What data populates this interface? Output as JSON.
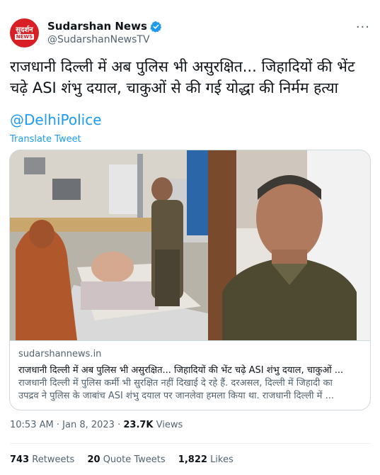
{
  "account": {
    "display_name": "Sudarshan News",
    "handle": "@SudarshanNewsTV",
    "avatar_text_top": "सुदर्शन",
    "avatar_text_bottom": "NEWS",
    "verified": true
  },
  "tweet": {
    "line1": "राजधानी दिल्ली में अब पुलिस भी असुरक्षित... जिहादियों की भेंट",
    "line2": "चढ़े ASI शंभु दयाल, चाकुओं से की गई योद्धा की निर्मम हत्या",
    "mention": "@DelhiPolice",
    "translate_label": "Translate Tweet"
  },
  "card": {
    "domain": "sudarshannews.in",
    "title": "राजधानी दिल्ली में अब पुलिस भी असुरक्षित... जिहादियों की भेंट चढ़े ASI शंभु दयाल, चाकुओं ...",
    "desc_line1": "राजधानी दिल्ली में पुलिस कर्मी भी सुरक्षित नहीं दिखाई दे रहे हैं. दरअसल, दिल्ली में जिहादी का",
    "desc_line2": "उपद्रव ने पुलिस के जाबांच ASI शंभु दयाल पर जानलेवा हमला किया था. राजधानी दिल्ली में ..."
  },
  "meta": {
    "time": "10:53 AM",
    "separator": "·",
    "date": "Jan 8, 2023",
    "views_count": "23.7K",
    "views_label": "Views"
  },
  "stats": {
    "retweets_count": "743",
    "retweets_label": "Retweets",
    "quotes_count": "20",
    "quotes_label": "Quote Tweets",
    "likes_count": "1,822",
    "likes_label": "Likes"
  },
  "colors": {
    "accent": "#1d9bf0",
    "text": "#0f1419",
    "secondary": "#536471",
    "brand_red": "#d81f26"
  }
}
